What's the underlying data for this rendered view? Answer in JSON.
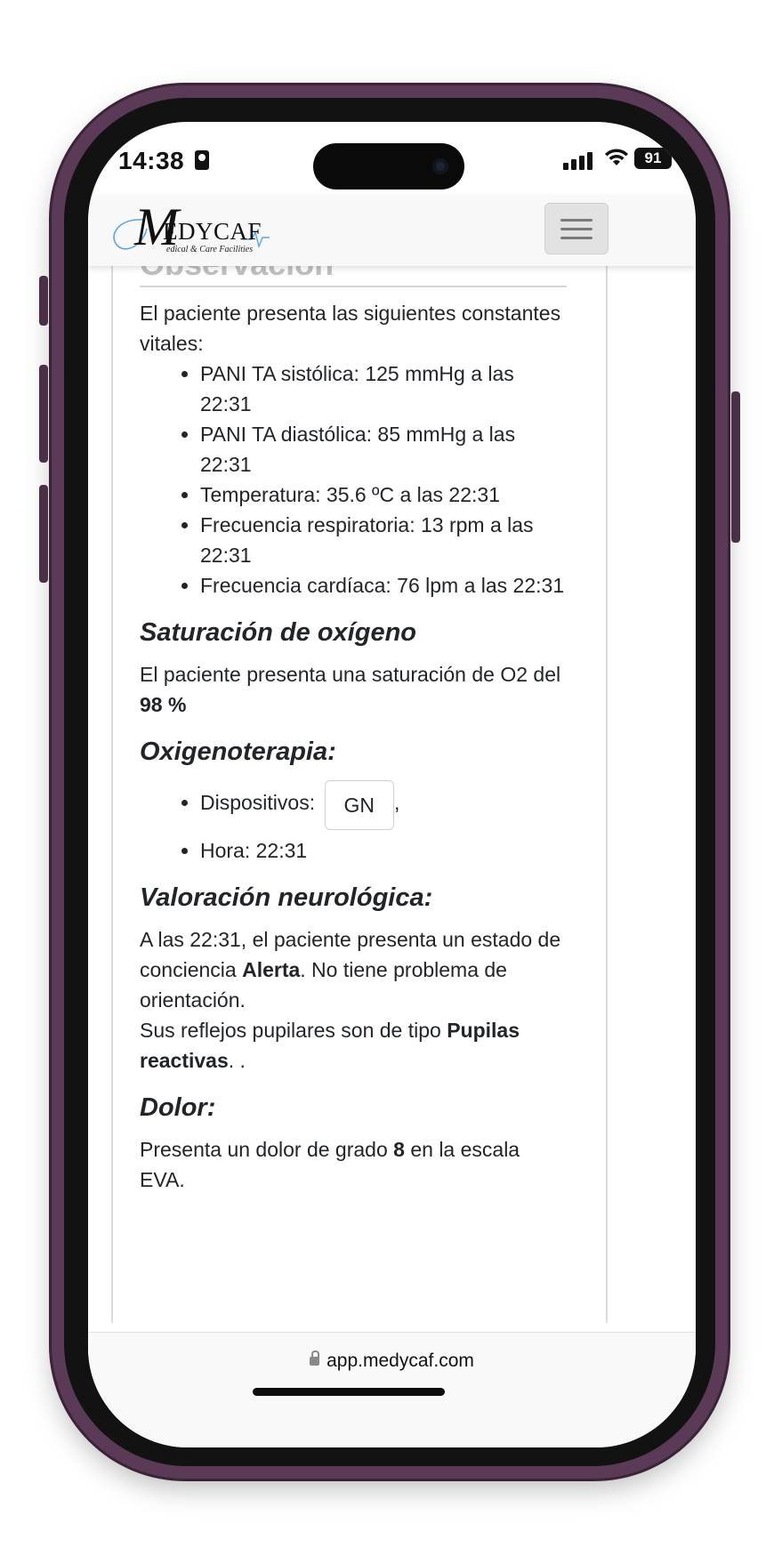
{
  "status_bar": {
    "time": "14:38",
    "battery": "91"
  },
  "header": {
    "logo_letter": "M",
    "logo_text": "EDYCAF",
    "logo_tagline": "edical & Care Facilities"
  },
  "content": {
    "section_title": "Observación",
    "vitals_intro": "El paciente presenta las siguientes constantes vitales:",
    "vitals": [
      "PANI TA sistólica: 125 mmHg a las 22:31",
      "PANI TA diastólica: 85 mmHg a las 22:31",
      "Temperatura: 35.6 ºC a las 22:31",
      "Frecuencia respiratoria: 13 rpm a las 22:31",
      "Frecuencia cardíaca: 76 lpm a las 22:31"
    ],
    "saturation": {
      "heading": "Saturación de oxígeno",
      "text": "El paciente presenta una saturación de O2 del",
      "value": "98 %"
    },
    "oxygen_therapy": {
      "heading": "Oxigenoterapia:",
      "devices_label": "Dispositivos:",
      "device": "GN",
      "after_device": ",",
      "time_label": "Hora: 22:31"
    },
    "neuro": {
      "heading": "Valoración neurológica:",
      "text1": "A las 22:31, el paciente presenta un estado de conciencia",
      "consciousness": "Alerta",
      "text2": ". No tiene problema de orientación.",
      "text3": "Sus reflejos pupilares son de tipo",
      "pupils": "Pupilas reactivas",
      "text4": ". ."
    },
    "pain": {
      "heading": "Dolor:",
      "text1": "Presenta un dolor de grado",
      "grade": "8",
      "text2": "en la escala EVA."
    }
  },
  "browser": {
    "url": "app.medycaf.com"
  }
}
